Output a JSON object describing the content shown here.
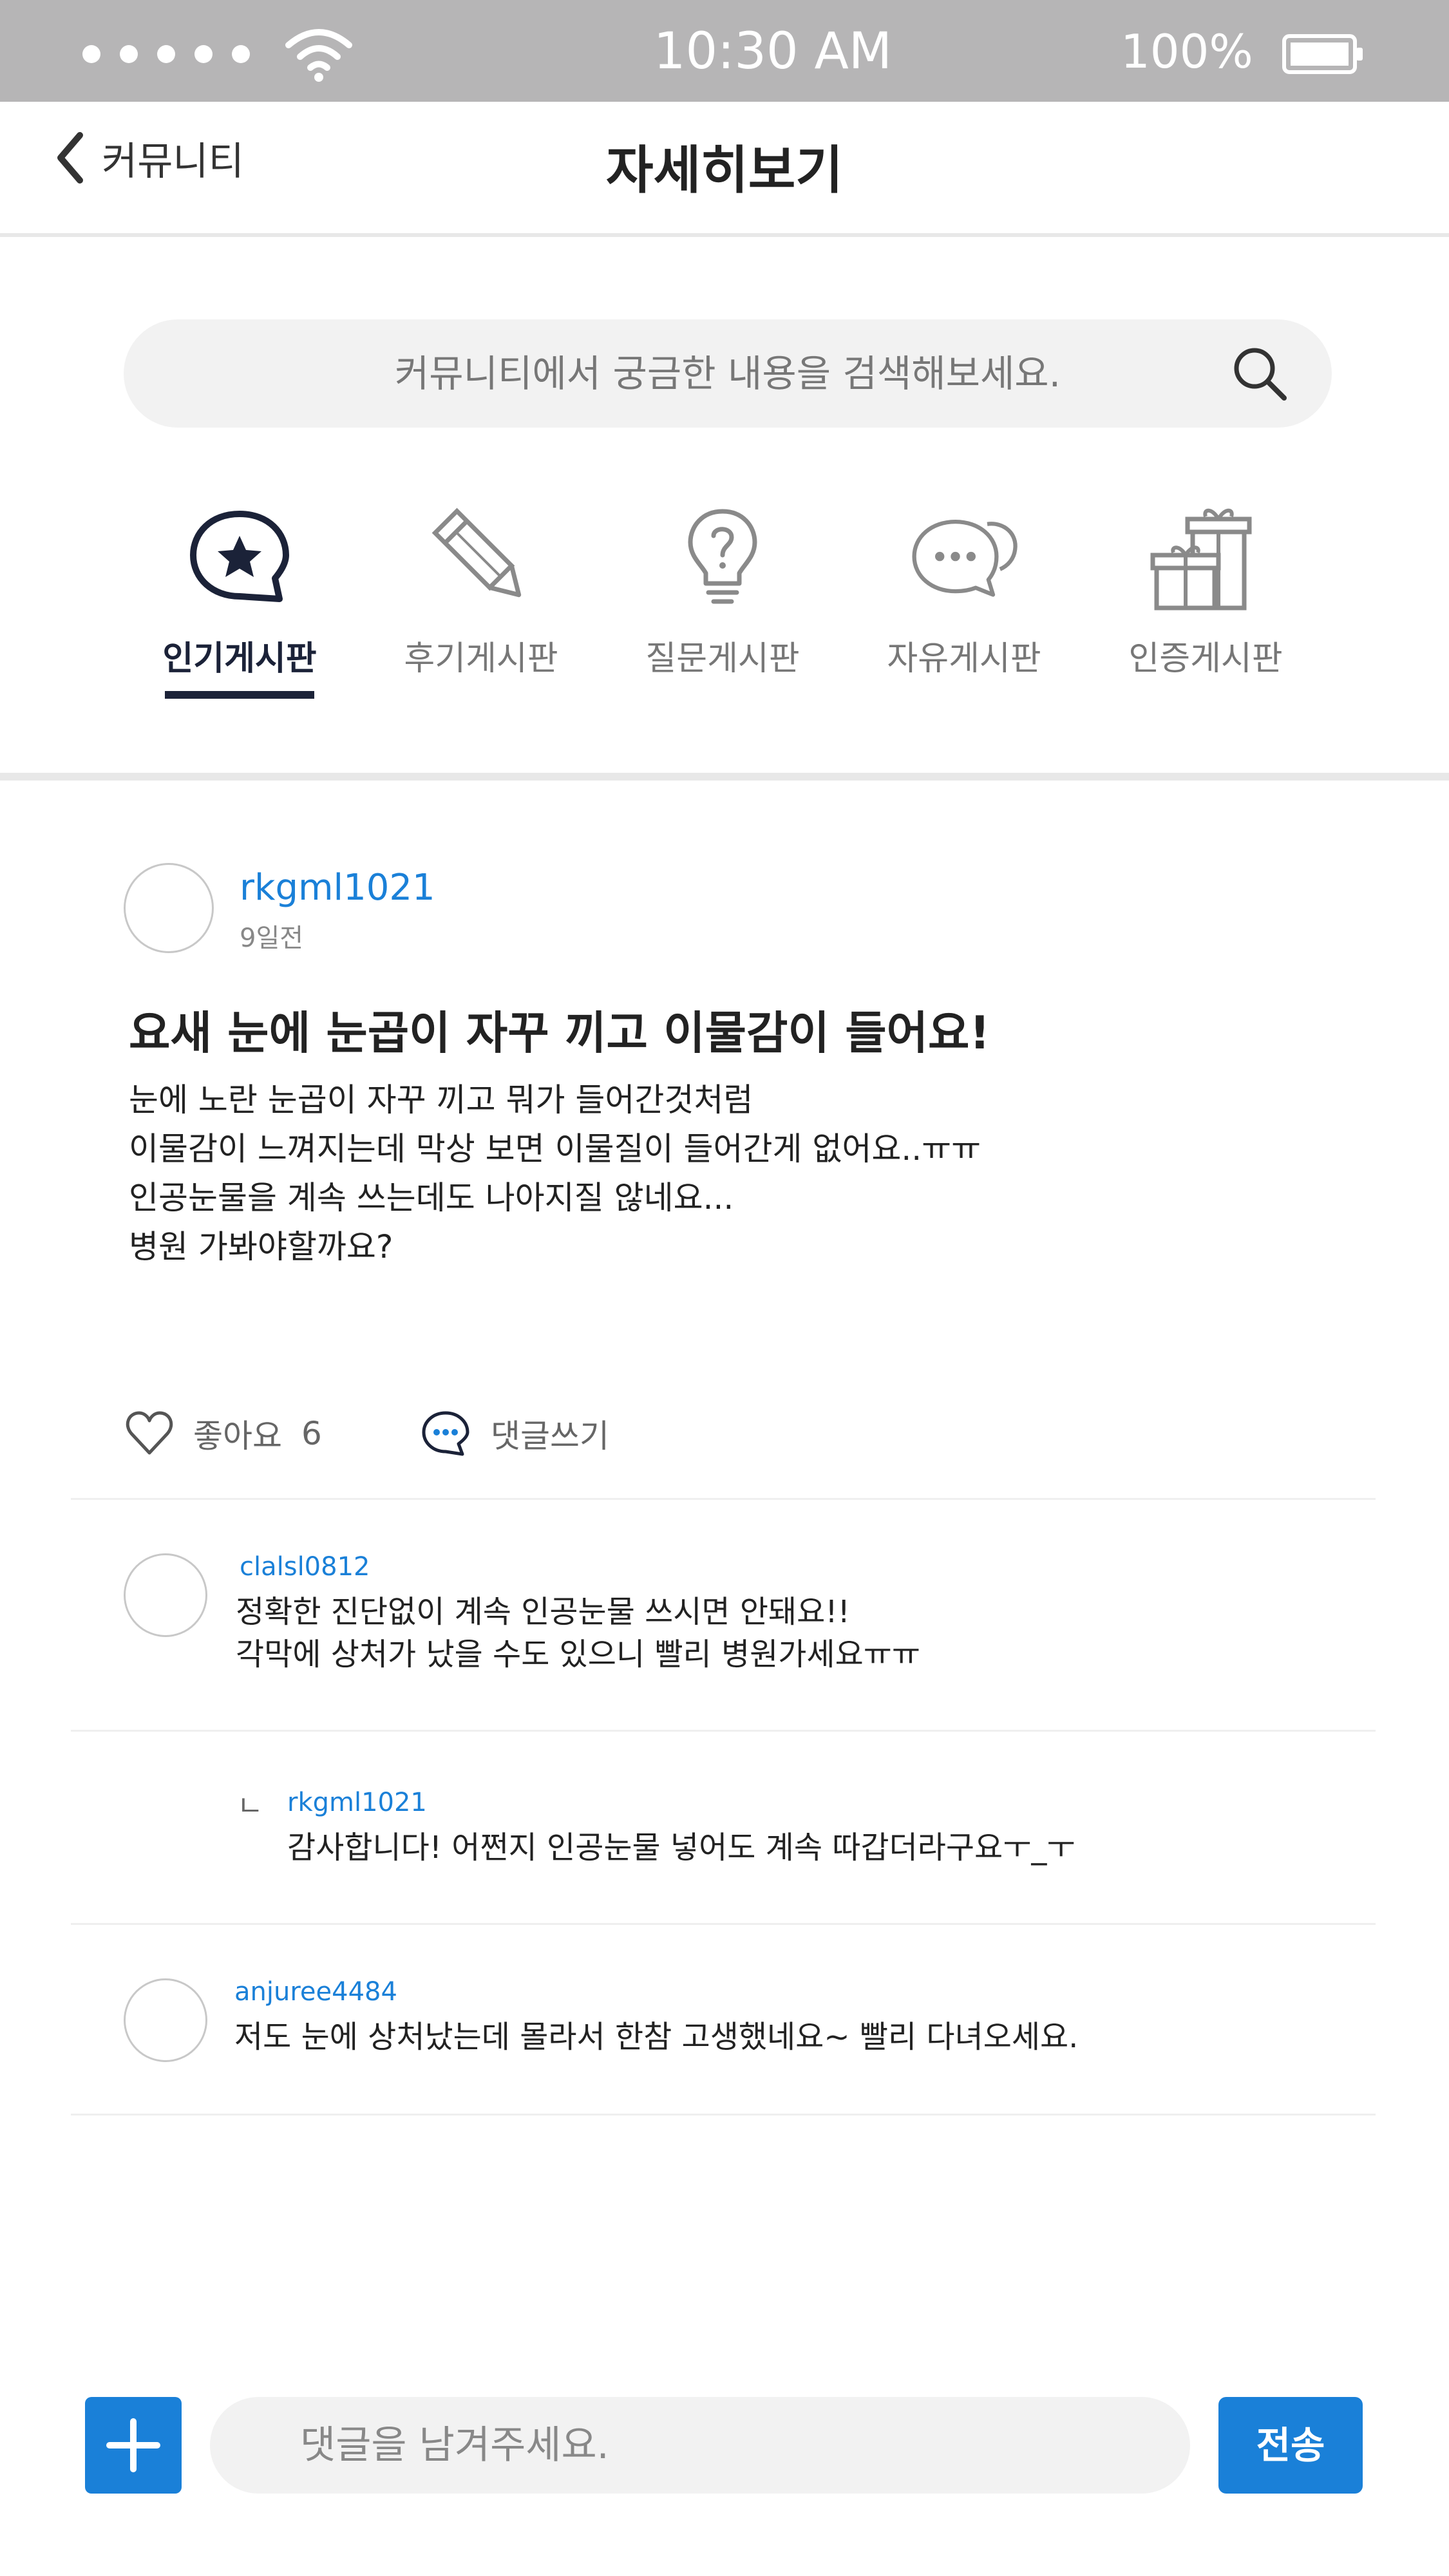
{
  "status_bar": {
    "time": "10:30 AM",
    "battery": "100%"
  },
  "header": {
    "back_label": "커뮤니티",
    "title": "자세히보기"
  },
  "search": {
    "placeholder": "커뮤니티에서 궁금한 내용을 검색해보세요."
  },
  "tabs": [
    {
      "label": "인기게시판",
      "icon": "star-bubble-icon",
      "active": true
    },
    {
      "label": "후기게시판",
      "icon": "pencil-icon",
      "active": false
    },
    {
      "label": "질문게시판",
      "icon": "lightbulb-question-icon",
      "active": false
    },
    {
      "label": "자유게시판",
      "icon": "chat-bubbles-icon",
      "active": false
    },
    {
      "label": "인증게시판",
      "icon": "gift-icon",
      "active": false
    }
  ],
  "post": {
    "author": "rkgml1021",
    "time": "9일전",
    "title": "요새 눈에 눈곱이 자꾸 끼고 이물감이 들어요!",
    "body": [
      "눈에 노란 눈곱이 자꾸 끼고 뭐가 들어간것처럼",
      "이물감이 느껴지는데 막상 보면 이물질이 들어간게 없어요..ㅠㅠ",
      "인공눈물을 계속 쓰는데도 나아지질 않네요...",
      "병원 가봐야할까요?"
    ],
    "like_label": "좋아요",
    "like_count": "6",
    "comment_label": "댓글쓰기"
  },
  "comments": [
    {
      "author": "clalsl0812",
      "lines": [
        "정확한 진단없이 계속 인공눈물 쓰시면 안돼요!!",
        "각막에 상처가 났을 수도 있으니 빨리 병원가세요ㅠㅠ"
      ]
    },
    {
      "reply_mark": "ㄴ",
      "author": "rkgml1021",
      "lines": [
        "감사합니다! 어쩐지 인공눈물 넣어도 계속 따갑더라구요ㅜ_ㅜ"
      ]
    },
    {
      "author": "anjuree4484",
      "lines": [
        "저도 눈에 상처났는데 몰라서 한참 고생했네요~ 빨리 다녀오세요."
      ]
    }
  ],
  "bottom_bar": {
    "input_placeholder": "댓글을 남겨주세요.",
    "send_label": "전송"
  },
  "colors": {
    "accent": "#1a80d8",
    "dark_navy": "#1b2238",
    "status_bar": "#b6b5b6"
  }
}
